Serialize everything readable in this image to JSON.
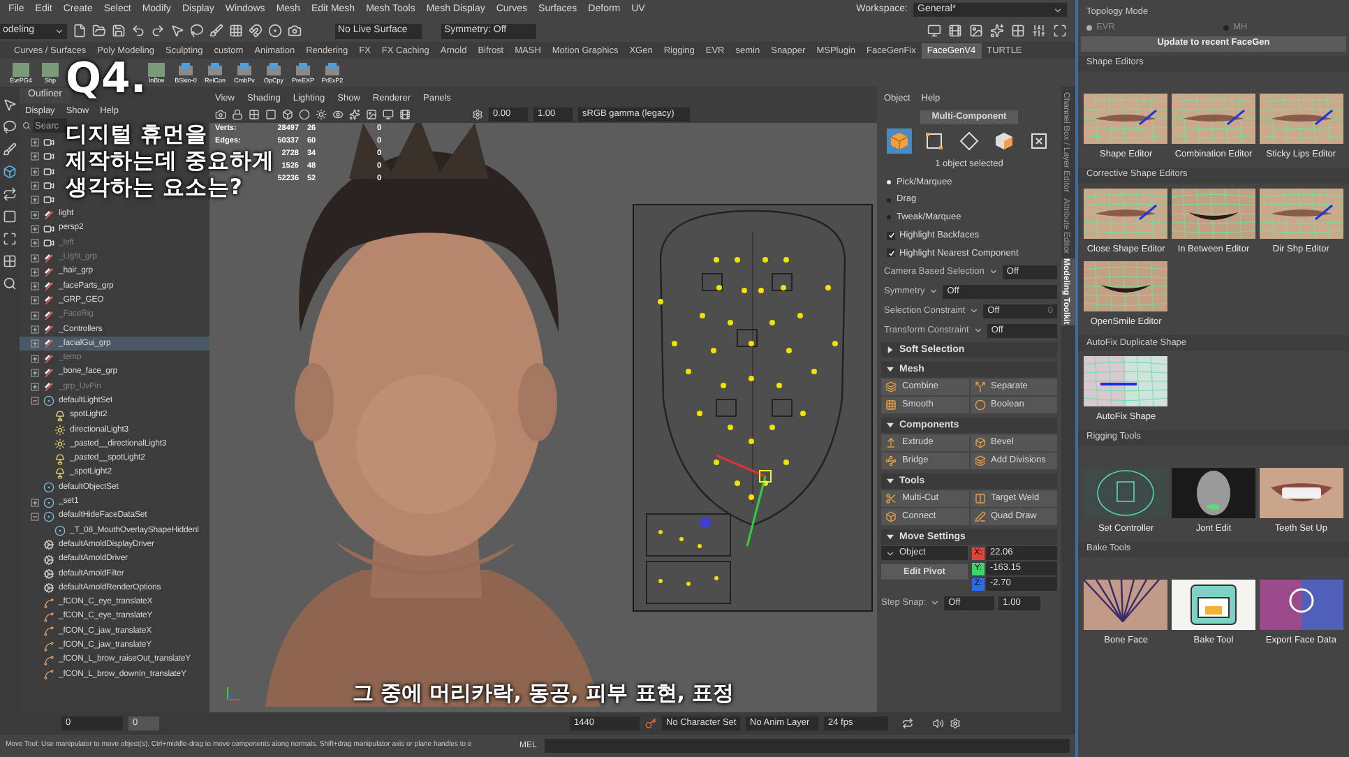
{
  "menu_bar": {
    "items": [
      "File",
      "Edit",
      "Create",
      "Select",
      "Modify",
      "Display",
      "Windows",
      "Mesh",
      "Edit Mesh",
      "Mesh Tools",
      "Mesh Display",
      "Curves",
      "Surfaces",
      "Deform",
      "UV"
    ],
    "workspace_label": "Workspace:",
    "workspace": "General*"
  },
  "status_line": {
    "mode": "odeling",
    "live_surface": "No Live Surface",
    "symmetry": "Symmetry: Off"
  },
  "shelf": {
    "tabs": [
      {
        "label": "Curves / Surfaces",
        "selected": false
      },
      {
        "label": "Poly Modeling",
        "selected": false
      },
      {
        "label": "Sculpting",
        "selected": false
      },
      {
        "label": "custom",
        "selected": false
      },
      {
        "label": "Animation",
        "selected": false
      },
      {
        "label": "Rendering",
        "selected": false
      },
      {
        "label": "FX",
        "selected": false
      },
      {
        "label": "FX Caching",
        "selected": false
      },
      {
        "label": "Arnold",
        "selected": false
      },
      {
        "label": "Bifrost",
        "selected": false
      },
      {
        "label": "MASH",
        "selected": false
      },
      {
        "label": "Motion Graphics",
        "selected": false
      },
      {
        "label": "XGen",
        "selected": false
      },
      {
        "label": "Rigging",
        "selected": false
      },
      {
        "label": "EVR",
        "selected": false
      },
      {
        "label": "semin",
        "selected": false
      },
      {
        "label": "Snapper",
        "selected": false
      },
      {
        "label": "MSPlugin",
        "selected": false
      },
      {
        "label": "FaceGenFix",
        "selected": false
      },
      {
        "label": "FaceGenV4",
        "selected": true
      },
      {
        "label": "TURTLE",
        "selected": false
      }
    ],
    "tools": [
      {
        "label": "EvrPG4",
        "kind": "thumb"
      },
      {
        "label": "Shp",
        "kind": "thumb"
      },
      {
        "label": "InBtw",
        "kind": "thumb"
      },
      {
        "label": "BSkin-0",
        "kind": "tool"
      },
      {
        "label": "RelCon",
        "kind": "tool"
      },
      {
        "label": "CmbPv",
        "kind": "tool"
      },
      {
        "label": "OpCpy",
        "kind": "tool"
      },
      {
        "label": "PreEXP",
        "kind": "tool"
      },
      {
        "label": "PrExP2",
        "kind": "tool"
      }
    ]
  },
  "caption": {
    "number": "Q4.",
    "question_lines": [
      "디지털 휴먼을",
      "제작하는데 중요하게",
      "생각하는 요소는?"
    ]
  },
  "outliner": {
    "title": "Outliner",
    "menu": [
      "Display",
      "Show",
      "Help"
    ],
    "placeholder": "Searc",
    "items": [
      {
        "kind": "camera",
        "expanded": false,
        "selected": false
      },
      {
        "kind": "camera",
        "expanded": false,
        "selected": false
      },
      {
        "kind": "camera",
        "expanded": false,
        "selected": false
      },
      {
        "kind": "camera",
        "expanded": false,
        "selected": false
      },
      {
        "kind": "camera",
        "expanded": false,
        "selected": false
      },
      {
        "label": "light",
        "kind": "group",
        "expanded": false,
        "selected": false,
        "dimmed": false
      },
      {
        "label": "persp2",
        "kind": "camera",
        "expanded": false,
        "selected": false,
        "dimmed": false
      },
      {
        "label": "_left",
        "kind": "camera",
        "expanded": false,
        "selected": false,
        "dimmed": true
      },
      {
        "label": "_Light_grp",
        "kind": "group",
        "expanded": false,
        "selected": false,
        "dimmed": true
      },
      {
        "label": "_hair_grp",
        "kind": "group",
        "expanded": false,
        "selected": false,
        "dimmed": false
      },
      {
        "label": "_faceParts_grp",
        "kind": "group",
        "expanded": false,
        "selected": false,
        "dimmed": false
      },
      {
        "label": "_GRP_GEO",
        "kind": "group",
        "expanded": false,
        "selected": false,
        "dimmed": false
      },
      {
        "label": "_FaceRig",
        "kind": "group",
        "expanded": false,
        "selected": false,
        "dimmed": true
      },
      {
        "label": "_Controllers",
        "kind": "group",
        "expanded": false,
        "selected": false,
        "dimmed": false
      },
      {
        "label": "_facialGui_grp",
        "kind": "group",
        "expanded": false,
        "selected": true,
        "dimmed": false
      },
      {
        "label": "_temp",
        "kind": "group",
        "expanded": false,
        "selected": false,
        "dimmed": true
      },
      {
        "label": "_bone_face_grp",
        "kind": "group",
        "expanded": false,
        "selected": false,
        "dimmed": false
      },
      {
        "label": "_grp_UvPin",
        "kind": "group",
        "expanded": false,
        "selected": false,
        "dimmed": true
      },
      {
        "label": "defaultLightSet",
        "kind": "set",
        "expanded": true,
        "selected": false,
        "dimmed": false,
        "children": [
          {
            "label": "spotLight2",
            "kind": "spot",
            "selected": false,
            "dimmed": false
          },
          {
            "label": "directionalLight3",
            "kind": "directional",
            "selected": false,
            "dimmed": false
          },
          {
            "label": "_pasted__directionalLight3",
            "kind": "directional",
            "selected": false,
            "dimmed": false
          },
          {
            "label": "_pasted__spotLight2",
            "kind": "spot",
            "selected": false,
            "dimmed": false
          },
          {
            "label": "_spotLight2",
            "kind": "spot",
            "selected": false,
            "dimmed": false
          }
        ]
      },
      {
        "label": "defaultObjectSet",
        "kind": "set",
        "selected": false,
        "dimmed": false
      },
      {
        "label": "_set1",
        "kind": "set",
        "expanded": false,
        "selected": false,
        "dimmed": false
      },
      {
        "label": "defaultHideFaceDataSet",
        "kind": "set",
        "expanded": true,
        "selected": false,
        "dimmed": false,
        "children": [
          {
            "label": "_T_08_MouthOverlayShapeHiddenl",
            "kind": "set",
            "selected": false,
            "dimmed": false
          }
        ]
      },
      {
        "label": "defaultArnoldDisplayDriver",
        "kind": "node",
        "selected": false,
        "dimmed": false
      },
      {
        "label": "defaultArnoldDriver",
        "kind": "node",
        "selected": false,
        "dimmed": false
      },
      {
        "label": "defaultArnoldFilter",
        "kind": "node",
        "selected": false,
        "dimmed": false
      },
      {
        "label": "defaultArnoldRenderOptions",
        "kind": "node",
        "selected": false,
        "dimmed": false
      },
      {
        "label": "_fCON_C_eye_translateX",
        "kind": "curve",
        "selected": false,
        "dimmed": false
      },
      {
        "label": "_fCON_C_eye_translateY",
        "kind": "curve",
        "selected": false,
        "dimmed": false
      },
      {
        "label": "_fCON_C_jaw_translateX",
        "kind": "curve",
        "selected": false,
        "dimmed": false
      },
      {
        "label": "_fCON_C_jaw_translateY",
        "kind": "curve",
        "selected": false,
        "dimmed": false
      },
      {
        "label": "_fCON_L_brow_raiseOut_translateY",
        "kind": "curve",
        "selected": false,
        "dimmed": false
      },
      {
        "label": "_fCON_L_brow_downIn_translateY",
        "kind": "curve",
        "selected": false,
        "dimmed": false
      }
    ]
  },
  "viewport": {
    "menu": [
      "View",
      "Shading",
      "Lighting",
      "Show",
      "Renderer",
      "Panels"
    ],
    "exposure": "0.00",
    "gamma": "1.00",
    "color_space": "sRGB gamma (legacy)",
    "stats": [
      {
        "label": "Verts:",
        "values": [
          "28497",
          "26",
          "0"
        ]
      },
      {
        "label": "Edges:",
        "values": [
          "50337",
          "60",
          "0"
        ]
      },
      {
        "values": [
          "2728",
          "34",
          "0"
        ]
      },
      {
        "values": [
          "1526",
          "48",
          "0"
        ]
      },
      {
        "values": [
          "52236",
          "52",
          "0"
        ]
      }
    ],
    "subtitle": "그 중에 머리카락, 동공, 피부 표현, 표정"
  },
  "toolkit": {
    "menu": [
      "Object",
      "Help"
    ],
    "mode_button": "Multi-Component",
    "modes": [
      {
        "kind": "object",
        "selected": true
      },
      {
        "kind": "vertex",
        "selected": false
      },
      {
        "kind": "edge",
        "selected": false
      },
      {
        "kind": "face",
        "selected": false
      },
      {
        "kind": "uv",
        "selected": false
      }
    ],
    "selection_info": "1 object selected",
    "pick_modes": [
      {
        "label": "Pick/Marquee",
        "selected": true
      },
      {
        "label": "Drag",
        "selected": false
      },
      {
        "label": "Tweak/Marquee",
        "selected": false
      }
    ],
    "options": [
      {
        "label": "Highlight Backfaces",
        "checked": true
      },
      {
        "label": "Highlight Nearest Component",
        "checked": true
      }
    ],
    "settings": [
      {
        "label": "Camera Based Selection",
        "value": "Off"
      },
      {
        "label": "Symmetry",
        "value": "Off"
      },
      {
        "label": "Selection Constraint",
        "value": "Off",
        "extra": "0"
      },
      {
        "label": "Transform Constraint",
        "value": "Off"
      }
    ],
    "sections": [
      {
        "title": "Soft Selection",
        "expanded": false
      },
      {
        "title": "Mesh",
        "expanded": true,
        "buttons": [
          {
            "label": "Combine",
            "kind": "combine"
          },
          {
            "label": "Separate",
            "kind": "separate"
          },
          {
            "label": "Smooth",
            "kind": "smooth"
          },
          {
            "label": "Boolean",
            "kind": "boolean"
          }
        ]
      },
      {
        "title": "Components",
        "expanded": true,
        "buttons": [
          {
            "label": "Extrude",
            "kind": "extrude"
          },
          {
            "label": "Bevel",
            "kind": "bevel"
          },
          {
            "label": "Bridge",
            "kind": "bridge"
          },
          {
            "label": "Add Divisions",
            "kind": "divide"
          }
        ]
      },
      {
        "title": "Tools",
        "expanded": true,
        "buttons": [
          {
            "label": "Multi-Cut",
            "kind": "cut"
          },
          {
            "label": "Target Weld",
            "kind": "weld"
          },
          {
            "label": "Connect",
            "kind": "connect"
          },
          {
            "label": "Quad Draw",
            "kind": "draw"
          }
        ]
      }
    ],
    "move_settings": {
      "title": "Move Settings",
      "expanded": true,
      "space": "Object",
      "pivot_button": "Edit Pivot",
      "coords": [
        {
          "axis": "X:",
          "value": "22.06",
          "color": "#e2443c"
        },
        {
          "axis": "Y:",
          "value": "-163.15",
          "color": "#3fd46a"
        },
        {
          "axis": "Z:",
          "value": "-2.70",
          "color": "#2f6be8"
        }
      ]
    },
    "step_snap": {
      "label": "Step Snap:",
      "value": "Off",
      "amount": "1.00"
    }
  },
  "side_tabs": [
    {
      "label": "Channel Box / Layer Editor",
      "selected": false
    },
    {
      "label": "Attribute Editor",
      "selected": false
    },
    {
      "label": "Modeling Toolkit",
      "selected": true
    }
  ],
  "facegen": {
    "topology_title": "Topology Mode",
    "topology": [
      {
        "label": "EVR",
        "selected": true
      },
      {
        "label": "MH",
        "selected": false
      }
    ],
    "update_button": "Update to recent FaceGen",
    "groups": [
      {
        "title": "Shape Editors",
        "tools": [
          {
            "label": "Shape Editor",
            "kind": "lips"
          },
          {
            "label": "Combination Editor",
            "kind": "lips"
          },
          {
            "label": "Sticky Lips Editor",
            "kind": "lips"
          }
        ]
      },
      {
        "title": "Corrective Shape Editors",
        "tools": [
          {
            "label": "Close Shape Editor",
            "kind": "lips"
          },
          {
            "label": "In Between Editor",
            "kind": "mouth"
          },
          {
            "label": "Dir Shp Editor",
            "kind": "lips"
          },
          {
            "label": "OpenSmile Editor",
            "kind": "mouth"
          }
        ]
      },
      {
        "title": "AutoFix Duplicate Shape",
        "tools": [
          {
            "label": "AutoFix Shape",
            "kind": "split"
          }
        ]
      },
      {
        "title": "Rigging Tools",
        "tools": [
          {
            "label": "Set Controller",
            "kind": "rig"
          },
          {
            "label": "Jont Edit",
            "kind": "scan"
          },
          {
            "label": "Teeth Set Up",
            "kind": "teeth"
          }
        ]
      },
      {
        "title": "Bake Tools",
        "tools": [
          {
            "label": "Bone Face",
            "kind": "bones"
          },
          {
            "label": "Bake Tool",
            "kind": "oven"
          },
          {
            "label": "Export Face Data",
            "kind": "engine"
          }
        ]
      }
    ]
  },
  "time_bar": {
    "start": "0",
    "start_box": "0",
    "end": "1440",
    "character_set": "No Character Set",
    "anim_layer": "No Anim Layer",
    "fps": "24 fps"
  },
  "help_line": {
    "text": "Move Tool: Use manipulator to move object(s). Ctrl+middle-drag to move components along normals. Shift+drag manipulator axis or plane handles to e",
    "mel": "MEL"
  }
}
